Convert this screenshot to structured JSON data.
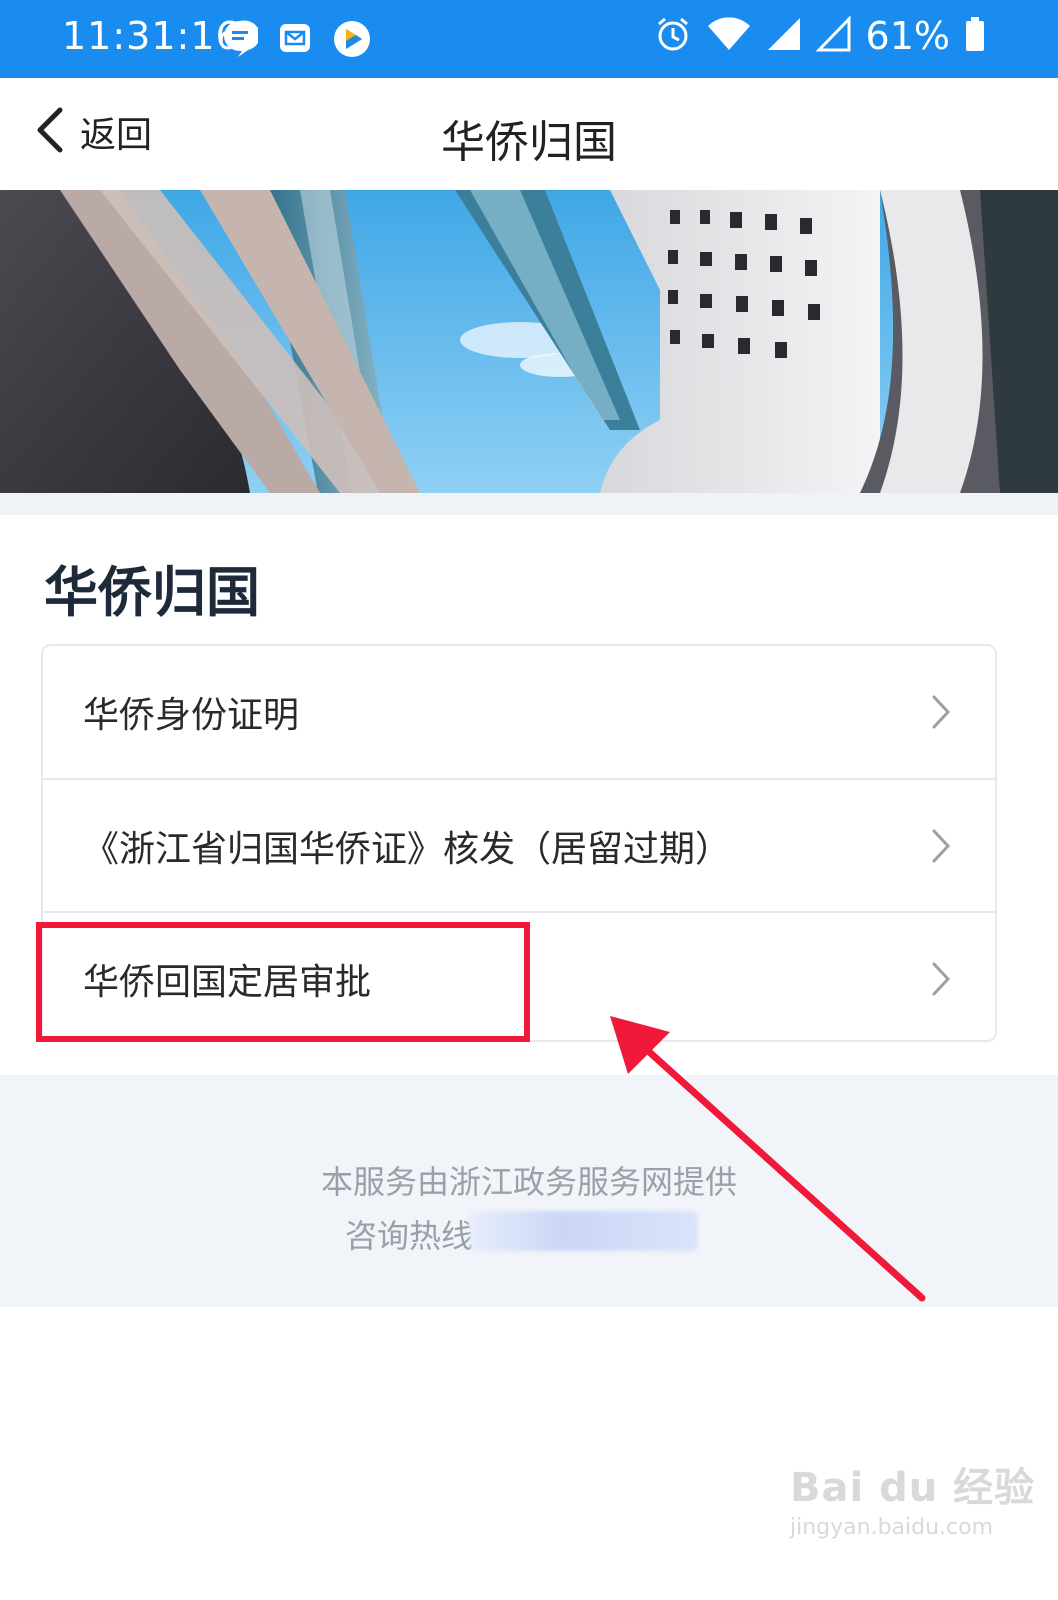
{
  "status_bar": {
    "time": "11:31:16",
    "battery": "61%",
    "icons": [
      "message-icon",
      "mail-icon",
      "video-app-icon",
      "alarm-icon",
      "wifi-icon",
      "signal-icon",
      "signal-empty-icon",
      "battery-icon"
    ],
    "bg_color": "#1a8cf0"
  },
  "navbar": {
    "back_label": "返回",
    "title": "华侨归国"
  },
  "section": {
    "title": "华侨归国",
    "items": [
      {
        "label": "华侨身份证明"
      },
      {
        "label": "《浙江省归国华侨证》核发（居留过期）"
      },
      {
        "label": "华侨回国定居审批"
      }
    ]
  },
  "footer": {
    "provider": "本服务由浙江政务服务网提供",
    "hotline_label": "咨询热线"
  },
  "annotation": {
    "highlight_color": "#f0193a"
  },
  "watermark": {
    "main": "Bai du 经验",
    "sub": "jingyan.baidu.com"
  }
}
